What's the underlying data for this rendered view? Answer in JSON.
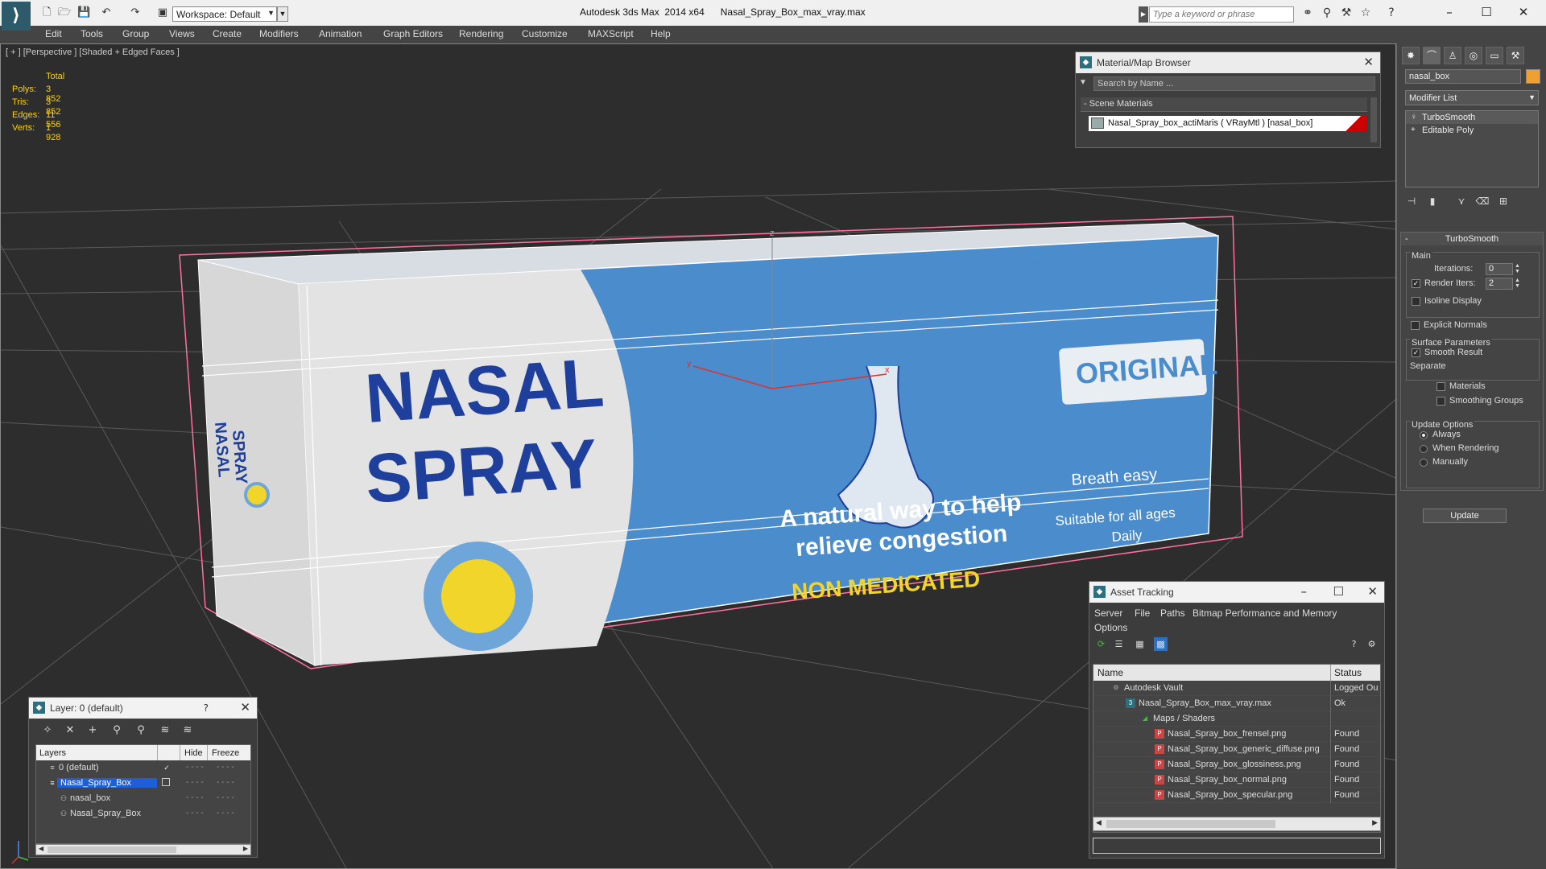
{
  "window": {
    "title": "Autodesk 3ds Max  2014 x64      Nasal_Spray_Box_max_vray.max",
    "workspace": "Workspace: Default",
    "search_placeholder": "Type a keyword or phrase",
    "minimize": "–",
    "maximize": "☐",
    "close": "✕"
  },
  "menu": [
    "Edit",
    "Tools",
    "Group",
    "Views",
    "Create",
    "Modifiers",
    "Animation",
    "Graph Editors",
    "Rendering",
    "Customize",
    "MAXScript",
    "Help"
  ],
  "viewport": {
    "label": "[ + ] [Perspective ] [Shaded + Edged Faces ]",
    "stats": {
      "header": "Total",
      "rows": [
        {
          "label": "Polys:",
          "value": "3 852"
        },
        {
          "label": "Tris:",
          "value": "3 852"
        },
        {
          "label": "Edges:",
          "value": "11 556"
        },
        {
          "label": "Verts:",
          "value": "1 928"
        }
      ]
    },
    "box_text": {
      "front_line1": "NASAL",
      "front_line2": "SPRAY",
      "original": "ORIGINAL",
      "tagline1": "A natural way to help",
      "tagline2": "relieve congestion",
      "non_medicated": "NON MEDICATED",
      "small1": "Breath easy",
      "small2": "Suitable for all ages",
      "small3": "Daily",
      "side_line1": "NASAL",
      "side_line2": "SPRAY"
    },
    "gizmo": {
      "x": "x",
      "y": "y",
      "z": "z"
    }
  },
  "material_browser": {
    "title": "Material/Map Browser",
    "search_placeholder": "Search by Name ...",
    "section": "- Scene Materials",
    "material": "Nasal_Spray_box_actiMaris  ( VRayMtl ) [nasal_box]",
    "close": "✕"
  },
  "command_panel": {
    "object_name": "nasal_box",
    "modifier_list": "Modifier List",
    "stack": [
      "TurboSmooth",
      "Editable Poly"
    ],
    "rollout_title": "TurboSmooth",
    "main_group": "Main",
    "iterations_label": "Iterations:",
    "iterations_value": "0",
    "render_iters_label": "Render Iters:",
    "render_iters_value": "2",
    "isoline_display": "Isoline Display",
    "explicit_normals": "Explicit Normals",
    "surface_group": "Surface Parameters",
    "smooth_result": "Smooth Result",
    "separate": "Separate",
    "materials": "Materials",
    "smoothing_groups": "Smoothing Groups",
    "update_group": "Update Options",
    "always": "Always",
    "when_rendering": "When Rendering",
    "manually": "Manually",
    "update_button": "Update"
  },
  "asset_tracking": {
    "title": "Asset Tracking",
    "menus": [
      "Server",
      "File",
      "Paths",
      "Bitmap Performance and Memory",
      "Options"
    ],
    "col_name": "Name",
    "col_status": "Status",
    "rows": [
      {
        "name": "Autodesk Vault",
        "status": "Logged Ou",
        "indent": 1
      },
      {
        "name": "Nasal_Spray_Box_max_vray.max",
        "status": "Ok",
        "indent": 2
      },
      {
        "name": "Maps / Shaders",
        "status": "",
        "indent": 3
      },
      {
        "name": "Nasal_Spray_box_frensel.png",
        "status": "Found",
        "indent": 4
      },
      {
        "name": "Nasal_Spray_box_generic_diffuse.png",
        "status": "Found",
        "indent": 4
      },
      {
        "name": "Nasal_Spray_box_glossiness.png",
        "status": "Found",
        "indent": 4
      },
      {
        "name": "Nasal_Spray_box_normal.png",
        "status": "Found",
        "indent": 4
      },
      {
        "name": "Nasal_Spray_box_specular.png",
        "status": "Found",
        "indent": 4
      }
    ],
    "minimize": "–",
    "maximize": "☐",
    "close": "✕"
  },
  "layer_manager": {
    "title": "Layer: 0 (default)",
    "help": "?",
    "close": "✕",
    "col_layers": "Layers",
    "col_hide": "Hide",
    "col_freeze": "Freeze",
    "rows": [
      {
        "name": "0 (default)",
        "indent": 1,
        "selected": false
      },
      {
        "name": "Nasal_Spray_Box",
        "indent": 1,
        "selected": true
      },
      {
        "name": "nasal_box",
        "indent": 2,
        "selected": false
      },
      {
        "name": "Nasal_Spray_Box",
        "indent": 2,
        "selected": false
      }
    ],
    "dash": "- - - -"
  },
  "colors": {
    "accent_select": "#1e5fd9",
    "stats_yellow": "#ffd200",
    "box_blue": "#4a8ccc",
    "box_dark_blue": "#1f3f9c",
    "box_yellow": "#f2d52a"
  }
}
